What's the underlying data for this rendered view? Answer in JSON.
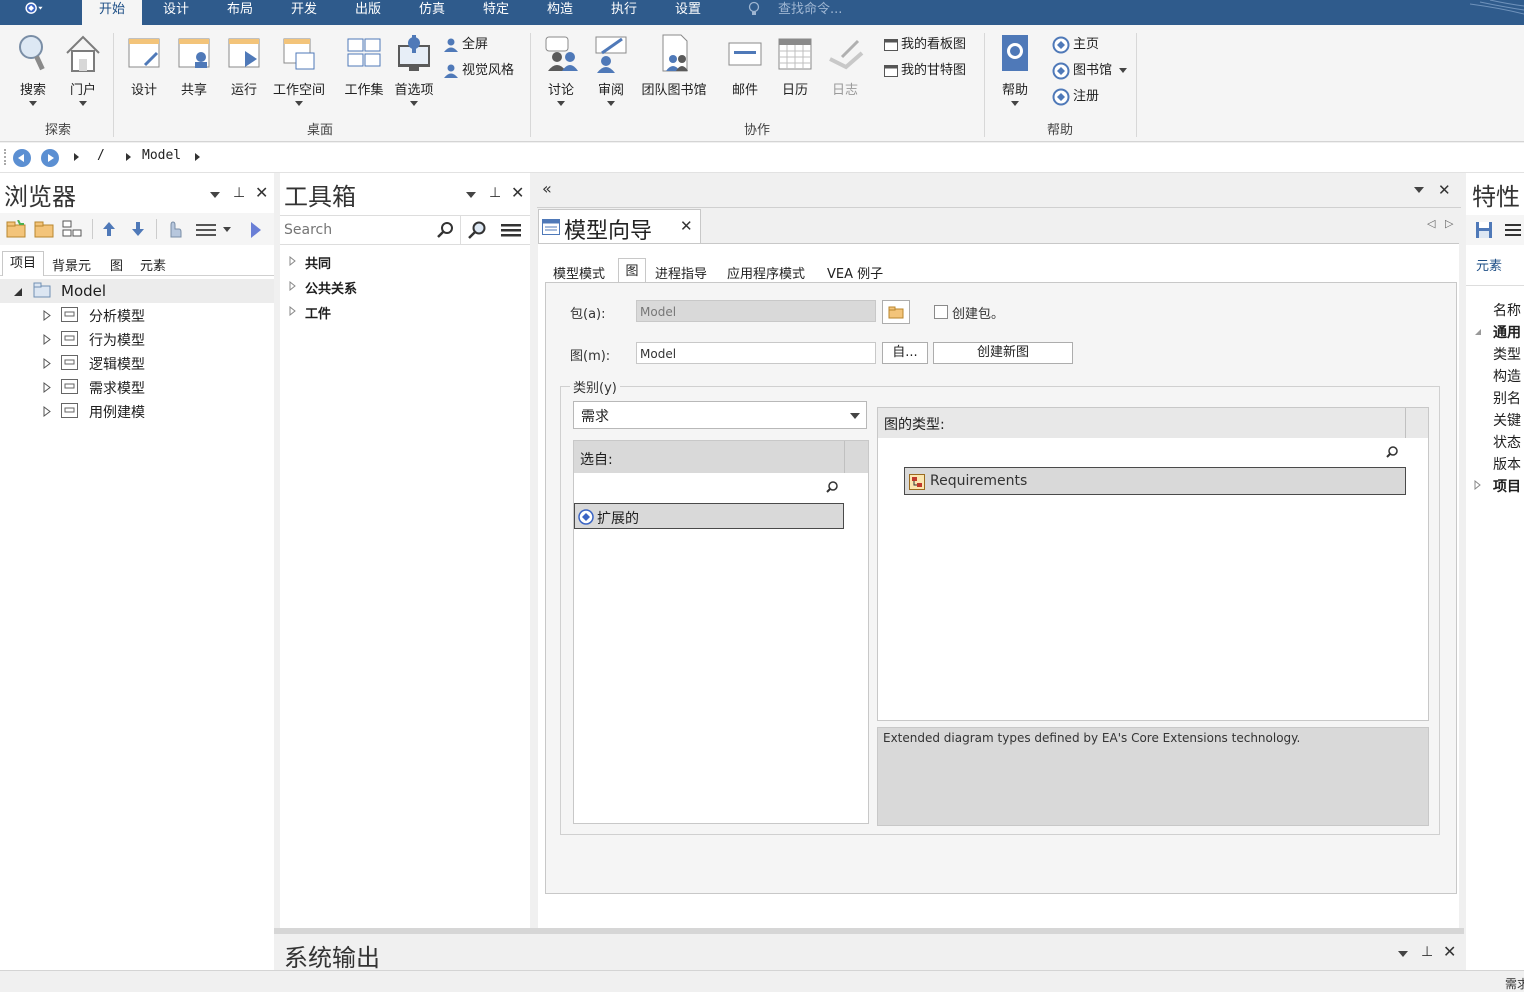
{
  "menu": {
    "tabs": [
      "开始",
      "设计",
      "布局",
      "开发",
      "出版",
      "仿真",
      "特定",
      "构造",
      "执行",
      "设置"
    ],
    "active_index": 0,
    "search_placeholder": "查找命令..."
  },
  "ribbon": {
    "explore": {
      "search": "搜索",
      "portal": "门户",
      "group": "探索"
    },
    "desktop": {
      "design": "设计",
      "share": "共享",
      "run": "运行",
      "workspace": "工作空间",
      "workset": "工作集",
      "preferences": "首选项",
      "fullscreen": "全屏",
      "visual_style": "视觉风格",
      "group": "桌面"
    },
    "collaborate": {
      "discuss": "讨论",
      "review": "审阅",
      "team_library": "团队图书馆",
      "mail": "邮件",
      "calendar": "日历",
      "journal": "日志",
      "my_kanban": "我的看板图",
      "my_gantt": "我的甘特图",
      "group": "协作"
    },
    "help": {
      "help": "帮助",
      "home": "主页",
      "library": "图书馆",
      "register": "注册",
      "group": "帮助"
    }
  },
  "address": {
    "root": "/",
    "model": "Model"
  },
  "browser": {
    "title": "浏览器",
    "tabs": [
      "项目",
      "背景元",
      "图",
      "元素"
    ],
    "root": "Model",
    "items": [
      "分析模型",
      "行为模型",
      "逻辑模型",
      "需求模型",
      "用例建模"
    ]
  },
  "toolbox": {
    "title": "工具箱",
    "search_placeholder": "Search",
    "groups": [
      "共同",
      "公共关系",
      "工件"
    ]
  },
  "wizard": {
    "tab_title": "模型向导",
    "tabs": [
      "模型模式",
      "图",
      "进程指导",
      "应用程序模式",
      "VEA 例子"
    ],
    "active_tab": 1,
    "package_label": "包(a):",
    "package_value": "Model",
    "create_package_label": "创建包。",
    "diagram_label": "图(m):",
    "diagram_value": "Model",
    "auto_button": "自...",
    "create_diagram_button": "创建新图",
    "category_label": "类别(y)",
    "category_value": "需求",
    "select_from_header": "选自:",
    "select_from_items": [
      "扩展的"
    ],
    "diagram_types_header": "图的类型:",
    "diagram_types_items": [
      "Requirements"
    ],
    "description": "Extended diagram types defined by EA's Core Extensions technology."
  },
  "properties": {
    "title": "特性",
    "tab": "元素",
    "rows": [
      "名称",
      "通用",
      "类型",
      "构造",
      "别名",
      "关键",
      "状态",
      "版本",
      "项目"
    ]
  },
  "output": {
    "title": "系统输出"
  },
  "status": {
    "text": "需求"
  }
}
